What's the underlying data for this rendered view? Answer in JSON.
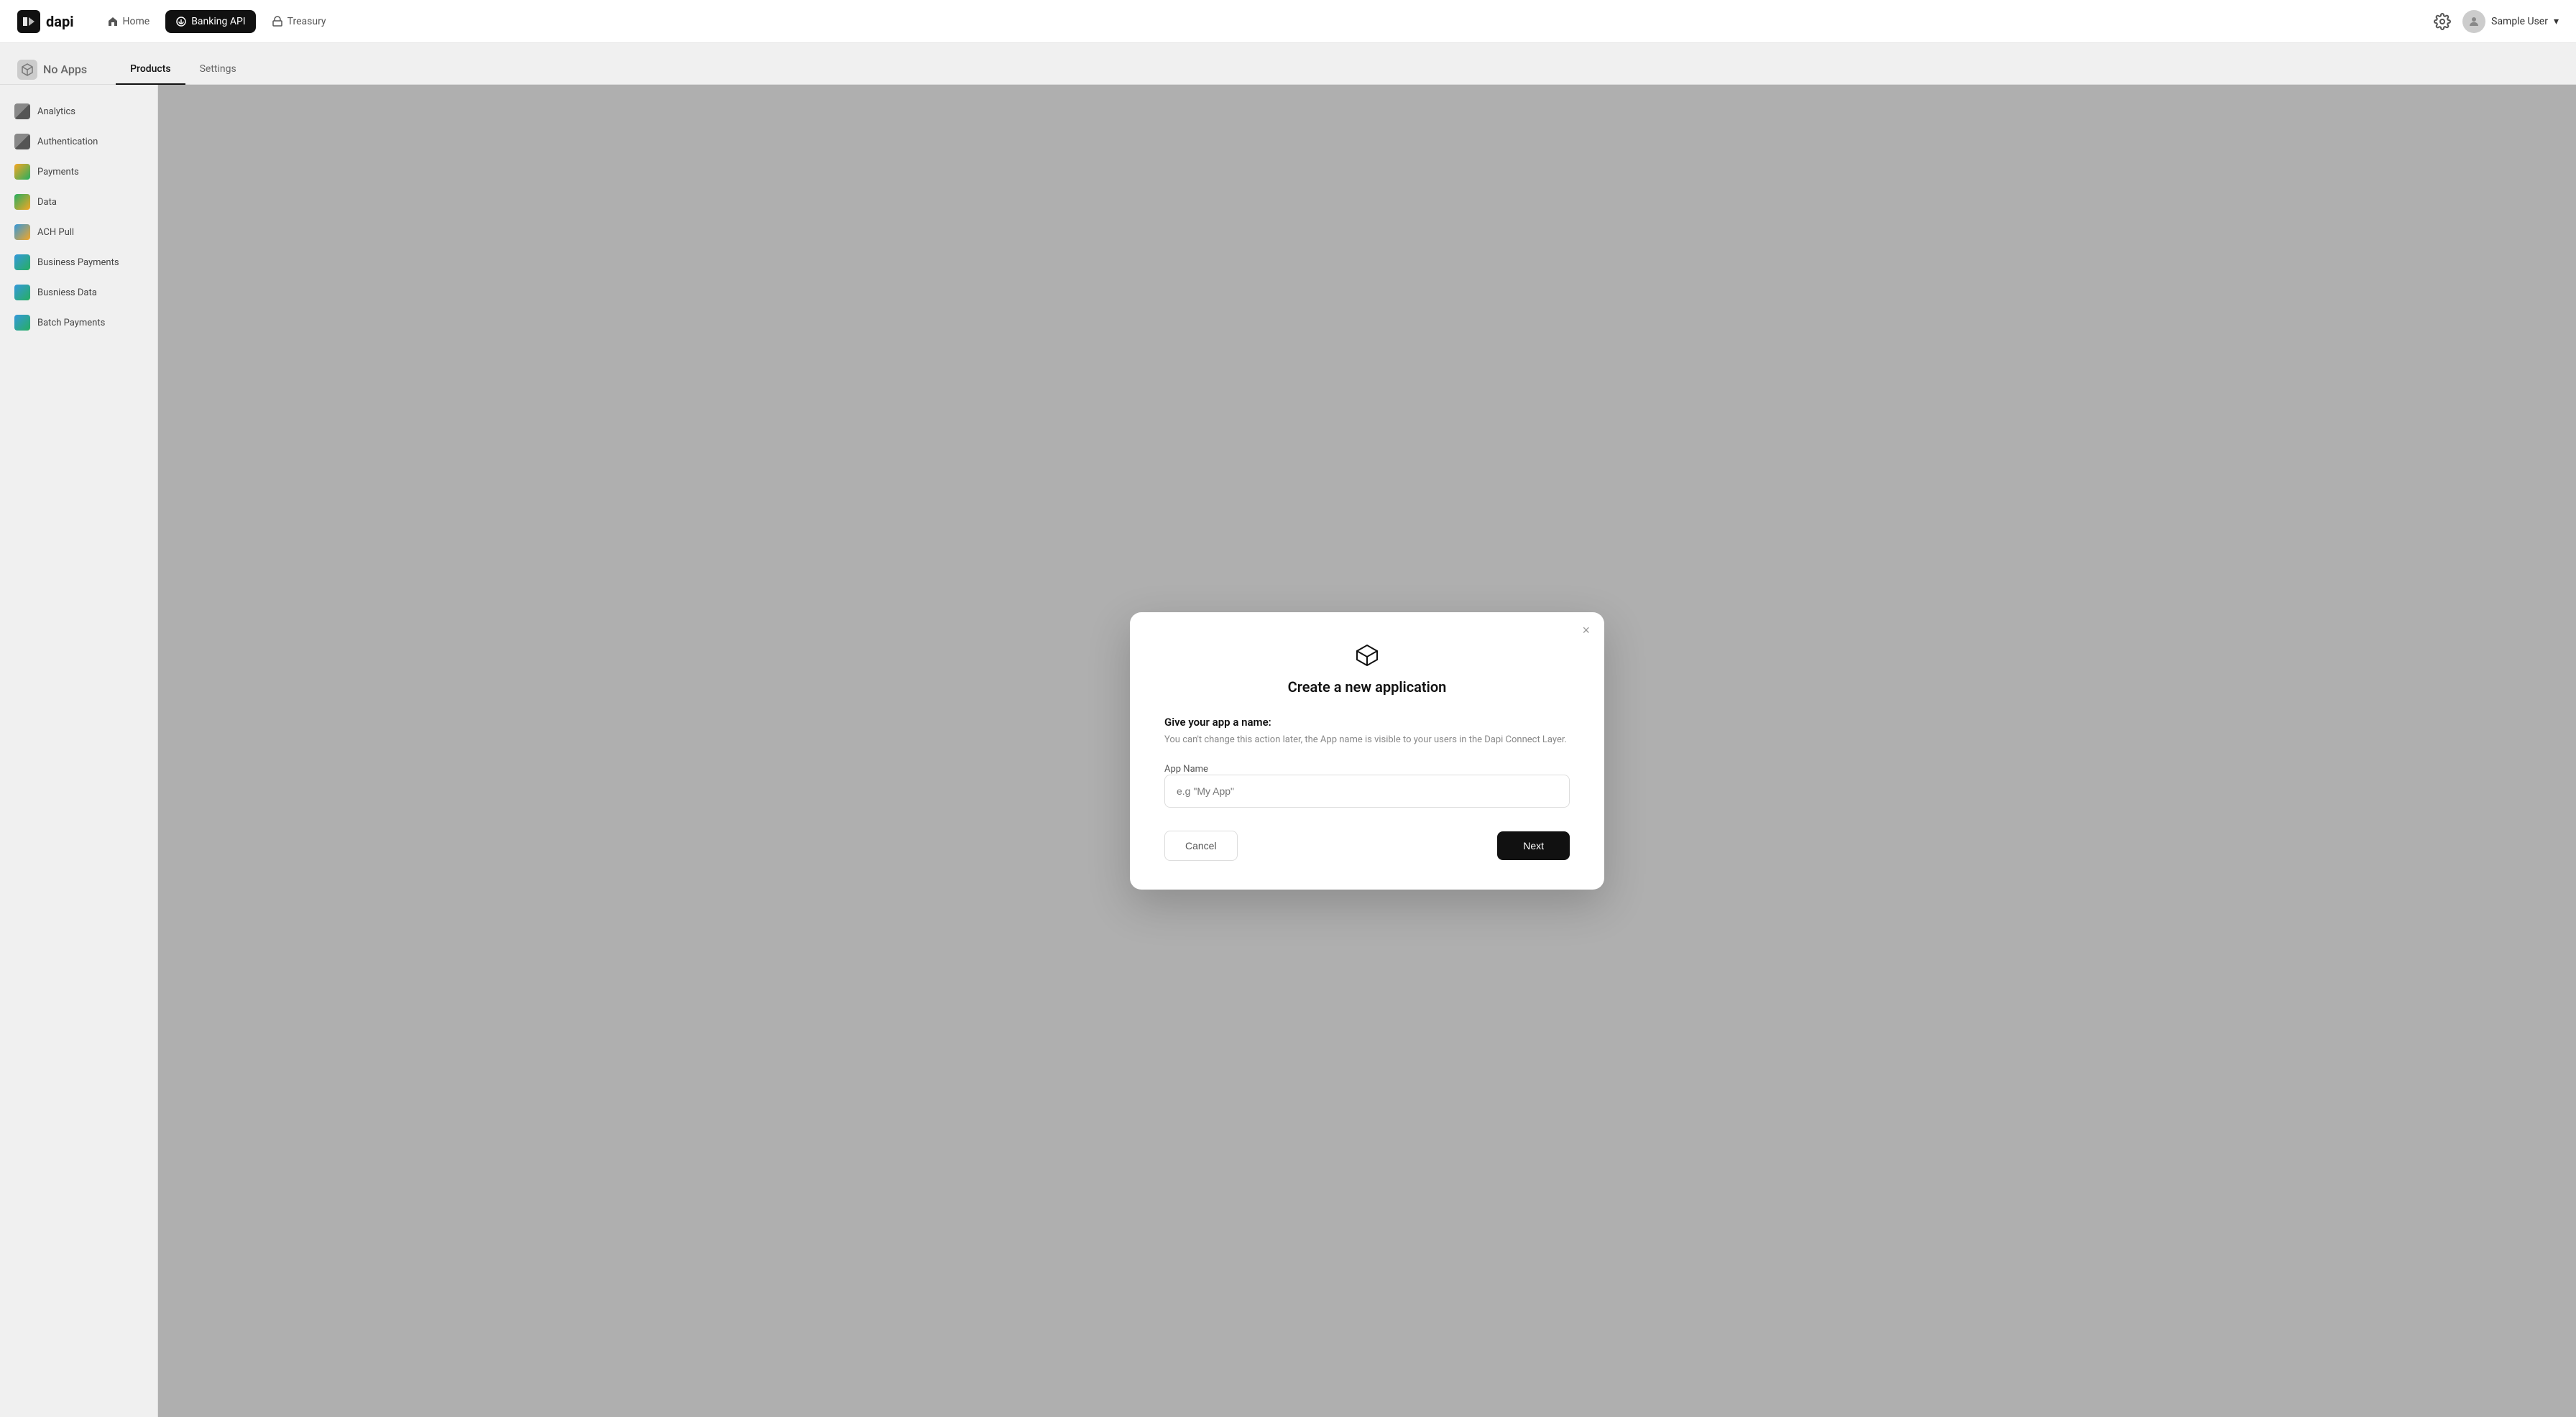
{
  "header": {
    "logo_text": "dapi",
    "nav": [
      {
        "label": "Home",
        "active": false,
        "icon": "home-icon"
      },
      {
        "label": "Banking API",
        "active": true,
        "icon": "banking-icon"
      },
      {
        "label": "Treasury",
        "active": false,
        "icon": "treasury-icon"
      }
    ],
    "user_label": "Sample User",
    "settings_label": "settings"
  },
  "sub_header": {
    "app_name": "No Apps",
    "tabs": [
      {
        "label": "Products",
        "active": true
      },
      {
        "label": "Settings",
        "active": false
      }
    ]
  },
  "sidebar": {
    "items": [
      {
        "label": "Analytics",
        "icon_class": "icon-analytics"
      },
      {
        "label": "Authentication",
        "icon_class": "icon-auth"
      },
      {
        "label": "Payments",
        "icon_class": "icon-payments"
      },
      {
        "label": "Data",
        "icon_class": "icon-data"
      },
      {
        "label": "ACH Pull",
        "icon_class": "icon-ach"
      },
      {
        "label": "Business Payments",
        "icon_class": "icon-business-payments"
      },
      {
        "label": "Busniess Data",
        "icon_class": "icon-business-data"
      },
      {
        "label": "Batch Payments",
        "icon_class": "icon-batch"
      }
    ]
  },
  "modal": {
    "close_label": "×",
    "title": "Create a new application",
    "heading": "Give your app a name:",
    "hint": "You can't change this action later, the App name is visible to your users in the Dapi Connect Layer.",
    "field_label": "App Name",
    "input_placeholder": "e.g \"My App\"",
    "cancel_label": "Cancel",
    "next_label": "Next"
  }
}
